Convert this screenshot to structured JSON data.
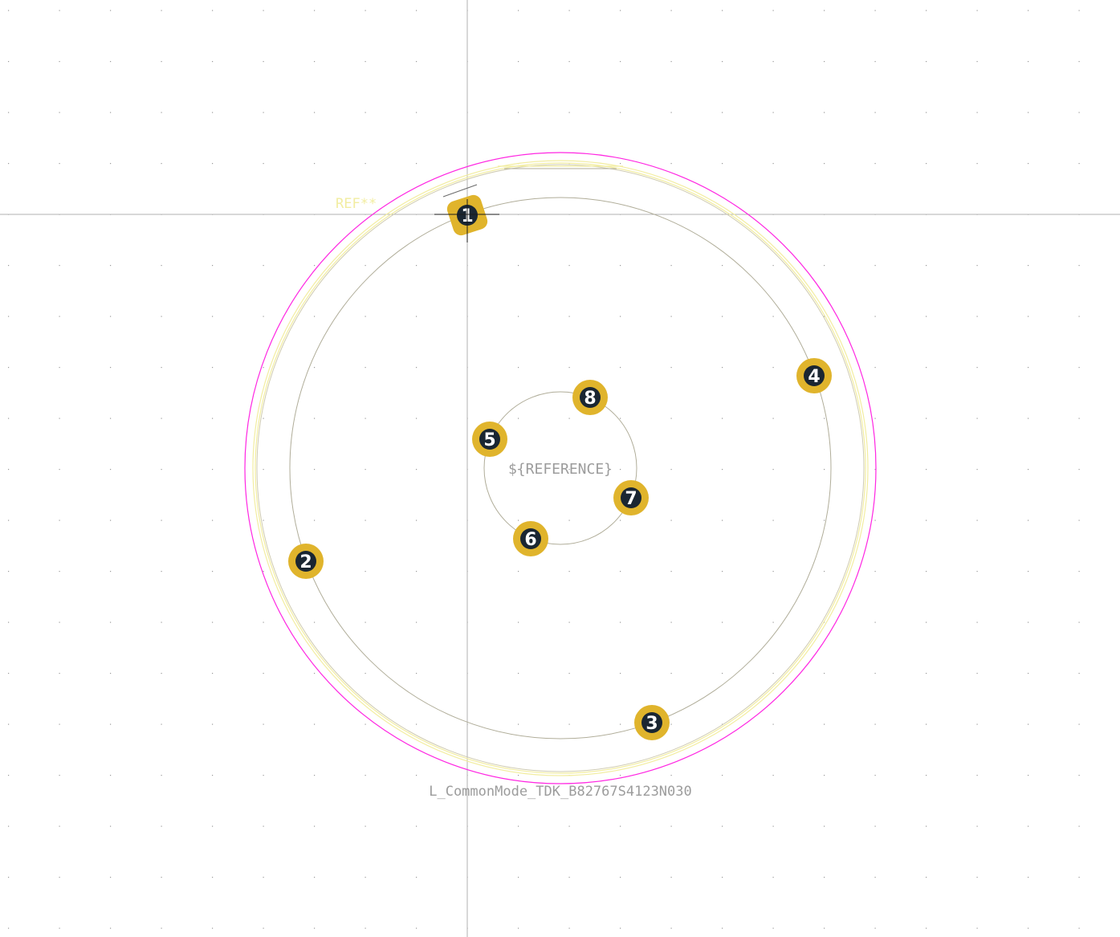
{
  "view": {
    "background": "#ffffff",
    "grid_color": "#9a9a9a",
    "crosshair_color": "#b0b0b0"
  },
  "footprint": {
    "ref_label": "REF**",
    "value_label": "L_CommonMode_TDK_B82767S4123N030",
    "reference_placeholder": "${REFERENCE}",
    "colors": {
      "courtyard": "#ff26e2",
      "silkscreen": "#f2eda1",
      "fab": "#b0ad99",
      "pad": "#e0b42c",
      "pad_hole": "#1a2632",
      "pad_text": "#ffffff",
      "value_text": "#9c9c9c",
      "ref_text": "#f2eda1"
    },
    "pads": [
      {
        "number": "1",
        "shape": "rounded-rect"
      },
      {
        "number": "2",
        "shape": "circle"
      },
      {
        "number": "3",
        "shape": "circle"
      },
      {
        "number": "4",
        "shape": "circle"
      },
      {
        "number": "5",
        "shape": "circle"
      },
      {
        "number": "6",
        "shape": "circle"
      },
      {
        "number": "7",
        "shape": "circle"
      },
      {
        "number": "8",
        "shape": "circle"
      }
    ]
  }
}
